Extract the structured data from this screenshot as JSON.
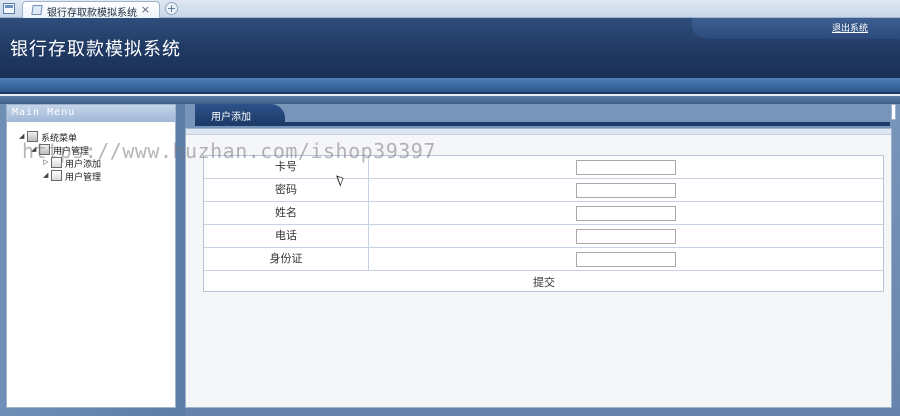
{
  "browser": {
    "tab_title": "银行存取款模拟系统",
    "close_glyph": "×",
    "new_tab_glyph": "+"
  },
  "header": {
    "app_title": "银行存取款模拟系统",
    "logout_label": "退出系统"
  },
  "sidebar": {
    "title": "Main Menu",
    "tree": [
      {
        "label": "系统菜单",
        "arrow": "◢",
        "level": 0
      },
      {
        "label": "用户管理",
        "arrow": "◢",
        "level": 1
      },
      {
        "label": "用户添加",
        "arrow": "▷",
        "level": 2
      },
      {
        "label": "用户管理",
        "arrow": "◢",
        "level": 1
      }
    ]
  },
  "main": {
    "tab_label": "用户添加",
    "form": {
      "fields": [
        {
          "label": "卡号",
          "value": ""
        },
        {
          "label": "密码",
          "value": ""
        },
        {
          "label": "姓名",
          "value": ""
        },
        {
          "label": "电话",
          "value": ""
        },
        {
          "label": "身份证",
          "value": ""
        }
      ],
      "submit_label": "提交"
    }
  },
  "watermark": "https://www.huzhan.com/ishop39397"
}
